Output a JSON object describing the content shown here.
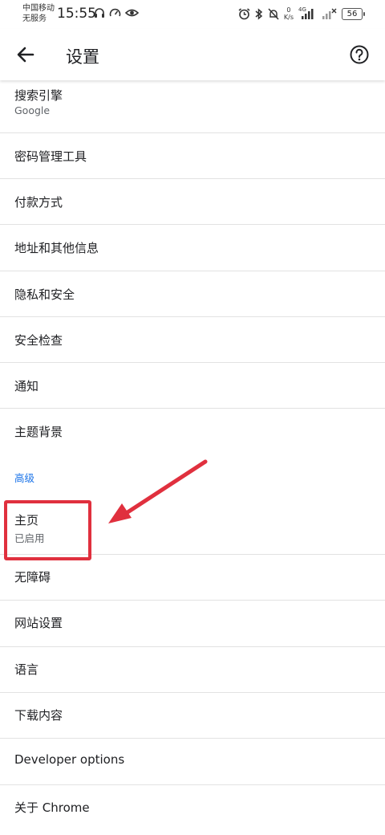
{
  "status_bar": {
    "carrier_line1": "中国移动",
    "carrier_line2": "无服务",
    "time": "15:55",
    "net_speed_value": "0",
    "net_speed_unit": "K/s",
    "network_type": "4G",
    "battery": "56"
  },
  "app_bar": {
    "title": "设置"
  },
  "settings": {
    "search_engine": {
      "label": "搜索引擎",
      "value": "Google"
    },
    "items": [
      {
        "label": "密码管理工具"
      },
      {
        "label": "付款方式"
      },
      {
        "label": "地址和其他信息"
      },
      {
        "label": "隐私和安全"
      },
      {
        "label": "安全检查"
      },
      {
        "label": "通知"
      },
      {
        "label": "主题背景"
      }
    ],
    "advanced_header": "高级",
    "homepage": {
      "label": "主页",
      "value": "已启用"
    },
    "advanced_items": [
      {
        "label": "无障碍"
      },
      {
        "label": "网站设置"
      },
      {
        "label": "语言"
      },
      {
        "label": "下载内容"
      },
      {
        "label": "Developer options"
      },
      {
        "label": "关于 Chrome"
      }
    ]
  },
  "colors": {
    "accent": "#1a73e8",
    "annotation": "#e0303e"
  }
}
